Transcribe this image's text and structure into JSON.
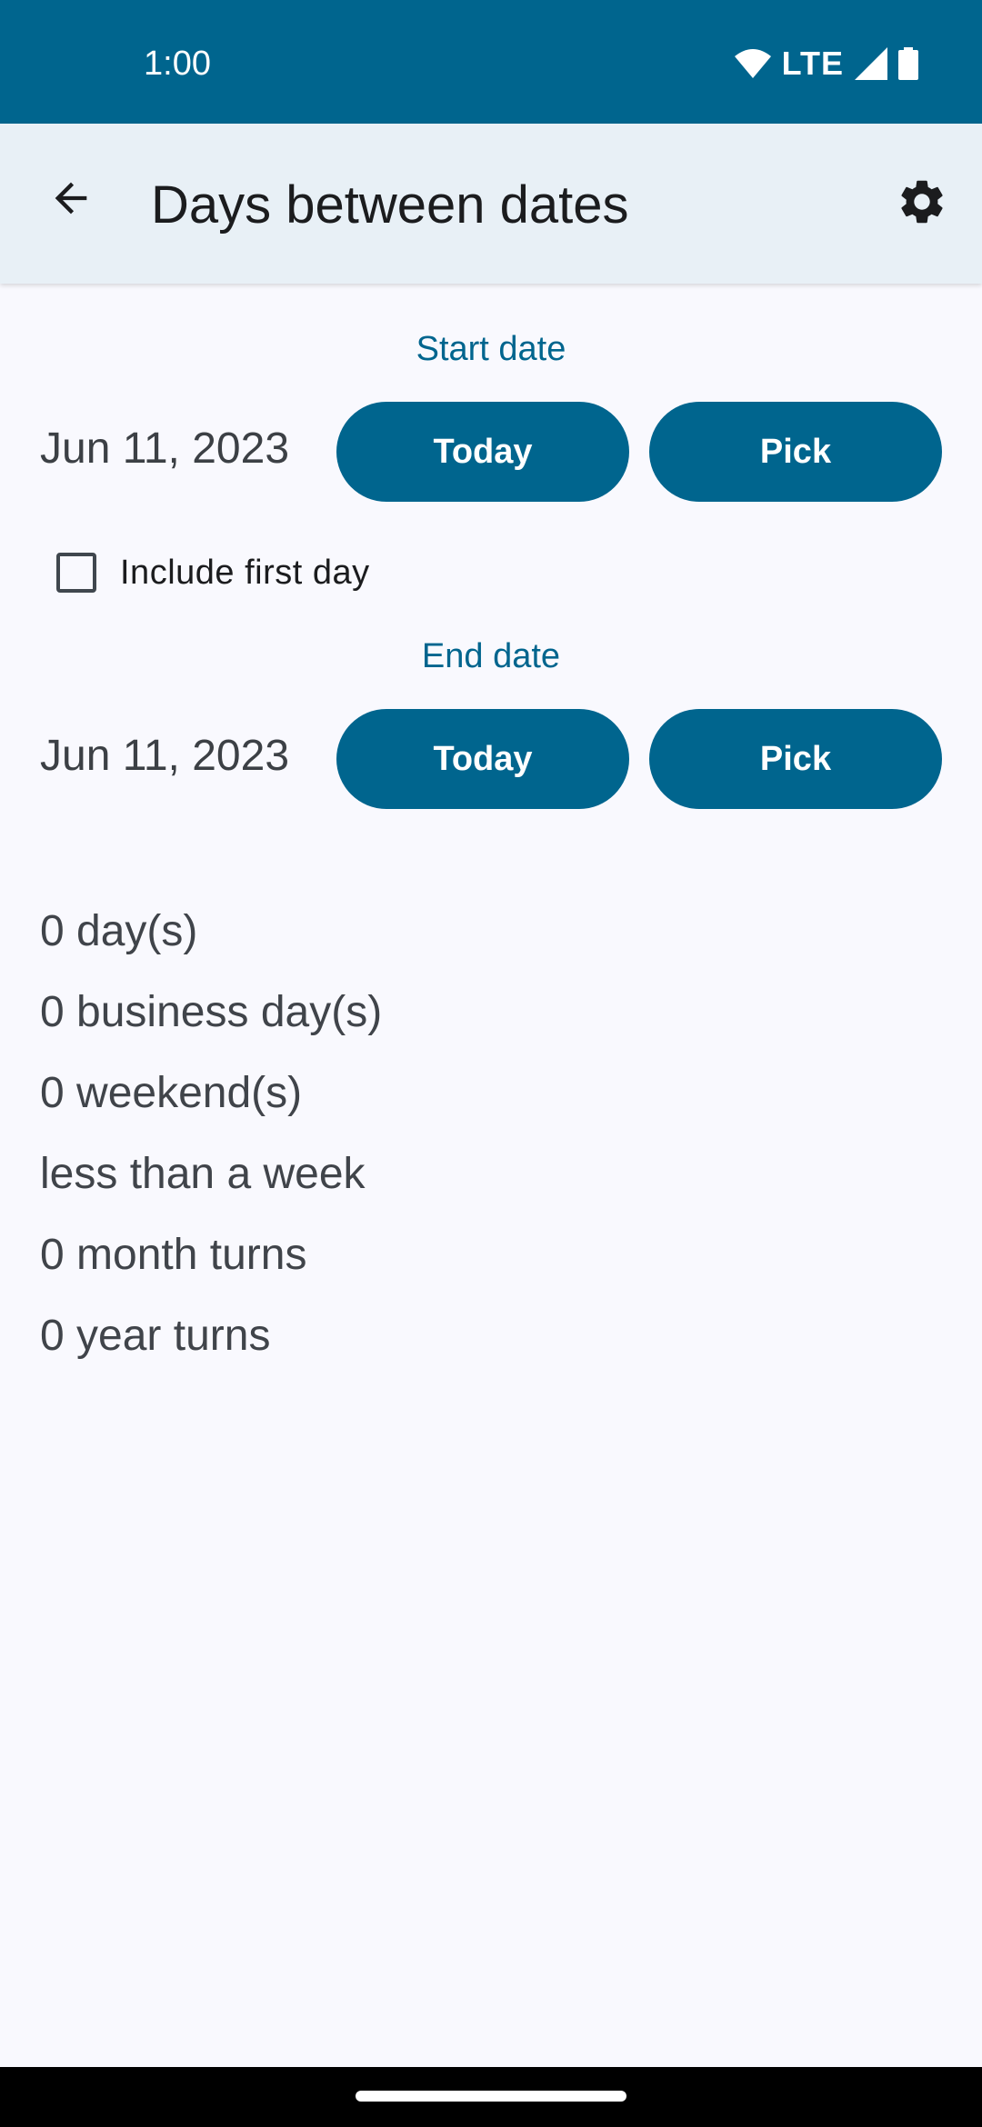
{
  "status_bar": {
    "time": "1:00",
    "network": "LTE",
    "icons": [
      "wifi-icon",
      "signal-icon",
      "battery-icon"
    ]
  },
  "app_bar": {
    "title": "Days between dates",
    "back_icon": "arrow-back-icon",
    "settings_icon": "gear-icon"
  },
  "start": {
    "label": "Start date",
    "date": "Jun 11, 2023",
    "today_label": "Today",
    "pick_label": "Pick"
  },
  "include_first_day": {
    "label": "Include first day",
    "checked": false
  },
  "end": {
    "label": "End date",
    "date": "Jun 11, 2023",
    "today_label": "Today",
    "pick_label": "Pick"
  },
  "results": [
    "0 day(s)",
    "0 business day(s)",
    "0 weekend(s)",
    "less than a week",
    "0 month turns",
    "0 year turns"
  ],
  "colors": {
    "primary": "#00658e",
    "app_bar": "#e8f0f6",
    "background": "#f9f9fe",
    "text": "#1b1c1e"
  }
}
